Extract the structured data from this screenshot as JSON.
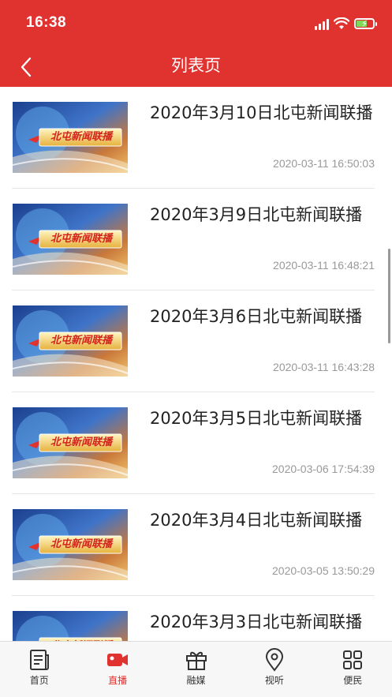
{
  "status": {
    "time": "16:38"
  },
  "header": {
    "title": "列表页"
  },
  "list": [
    {
      "title": "2020年3月10日北屯新闻联播",
      "time": "2020-03-11 16:50:03",
      "thumb_text": "北屯新闻联播"
    },
    {
      "title": "2020年3月9日北屯新闻联播",
      "time": "2020-03-11 16:48:21",
      "thumb_text": "北屯新闻联播"
    },
    {
      "title": "2020年3月6日北屯新闻联播",
      "time": "2020-03-11 16:43:28",
      "thumb_text": "北屯新闻联播"
    },
    {
      "title": "2020年3月5日北屯新闻联播",
      "time": "2020-03-06 17:54:39",
      "thumb_text": "北屯新闻联播"
    },
    {
      "title": "2020年3月4日北屯新闻联播",
      "time": "2020-03-05 13:50:29",
      "thumb_text": "北屯新闻联播"
    },
    {
      "title": "2020年3月3日北屯新闻联播",
      "time": "",
      "thumb_text": "北屯新闻联播"
    }
  ],
  "tabbar": {
    "items": [
      {
        "label": "首页",
        "icon": "news-icon",
        "active": false
      },
      {
        "label": "直播",
        "icon": "video-camera-icon",
        "active": true
      },
      {
        "label": "融媒",
        "icon": "gift-icon",
        "active": false
      },
      {
        "label": "视听",
        "icon": "location-pin-icon",
        "active": false
      },
      {
        "label": "便民",
        "icon": "grid-icon",
        "active": false
      }
    ]
  },
  "colors": {
    "brand": "#e0322f",
    "active_tab": "#e0322f",
    "time_text": "#999999"
  }
}
